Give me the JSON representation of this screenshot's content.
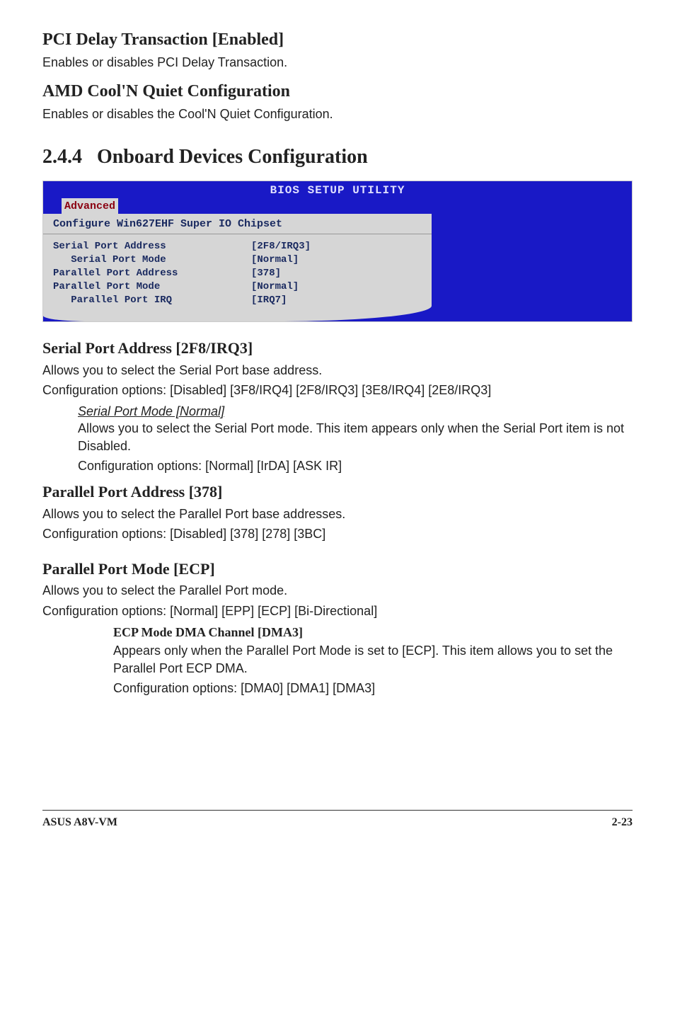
{
  "sec_pci": {
    "heading": "PCI Delay Transaction [Enabled]",
    "body": "Enables or disables  PCI Delay Transaction."
  },
  "sec_amd": {
    "heading": "AMD Cool'N Quiet Configuration",
    "body": "Enables or disables the Cool'N Quiet Configuration."
  },
  "subsection": {
    "number": "2.4.4",
    "title": "Onboard Devices Configuration"
  },
  "bios": {
    "title": "BIOS SETUP UTILITY",
    "tab": "Advanced",
    "panel_title": "Configure Win627EHF Super IO Chipset",
    "rows": [
      {
        "label": "Serial Port Address",
        "value": "[2F8/IRQ3]"
      },
      {
        "label": "   Serial Port Mode",
        "value": "[Normal]"
      },
      {
        "label": "Parallel Port Address",
        "value": "[378]"
      },
      {
        "label": "Parallel Port Mode",
        "value": "[Normal]"
      },
      {
        "label": "   Parallel Port IRQ",
        "value": "[IRQ7]"
      }
    ]
  },
  "field_serial_addr": {
    "heading": "Serial Port Address [2F8/IRQ3]",
    "line1": "Allows you to select the Serial Port base address.",
    "line2": "Configuration options: [Disabled] [3F8/IRQ4] [2F8/IRQ3] [3E8/IRQ4] [2E8/IRQ3]"
  },
  "field_serial_mode": {
    "title": "Serial Port Mode [Normal]",
    "body": "Allows you to select the Serial Port mode. This item appears only when the Serial Port item is not Disabled.",
    "opts": "Configuration options: [Normal] [IrDA] [ASK IR]"
  },
  "field_par_addr": {
    "heading": "Parallel Port Address [378]",
    "line1": "Allows you to select the Parallel Port base addresses.",
    "line2": "Configuration options: [Disabled] [378] [278] [3BC]"
  },
  "field_par_mode": {
    "heading": "Parallel Port Mode [ECP]",
    "line1": "Allows you to select the Parallel Port  mode.",
    "line2": "Configuration options: [Normal] [EPP] [ECP] [Bi-Directional]"
  },
  "field_ecp": {
    "title": "ECP Mode DMA Channel [DMA3]",
    "body": "Appears only when the Parallel Port Mode is set to [ECP]. This item allows you to set the Parallel Port ECP DMA.",
    "opts": "Configuration options: [DMA0] [DMA1] [DMA3]"
  },
  "footer": {
    "left": "ASUS A8V-VM",
    "right": "2-23"
  }
}
